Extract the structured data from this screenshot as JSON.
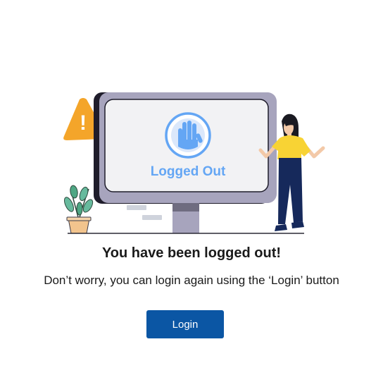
{
  "illustration": {
    "screen_label": "Logged Out",
    "warning_symbol": "!",
    "colors": {
      "monitor_frame": "#a7a4bd",
      "monitor_back": "#1f1d2b",
      "screen": "#f2f2f4",
      "accent_blue": "#64a6f4",
      "warning_orange": "#f4a52a",
      "shirt_yellow": "#f8d334",
      "pants_navy": "#16295b",
      "plant_green": "#67ba9d"
    },
    "icons": [
      "hand-stop-icon",
      "warning-triangle-icon",
      "potted-plant-icon",
      "person-figure"
    ]
  },
  "message": {
    "title": "You have been logged out!",
    "body": "Don’t worry, you can login again using the ‘Login’ button"
  },
  "actions": {
    "login_label": "Login",
    "login_color": "#0b56a4"
  }
}
